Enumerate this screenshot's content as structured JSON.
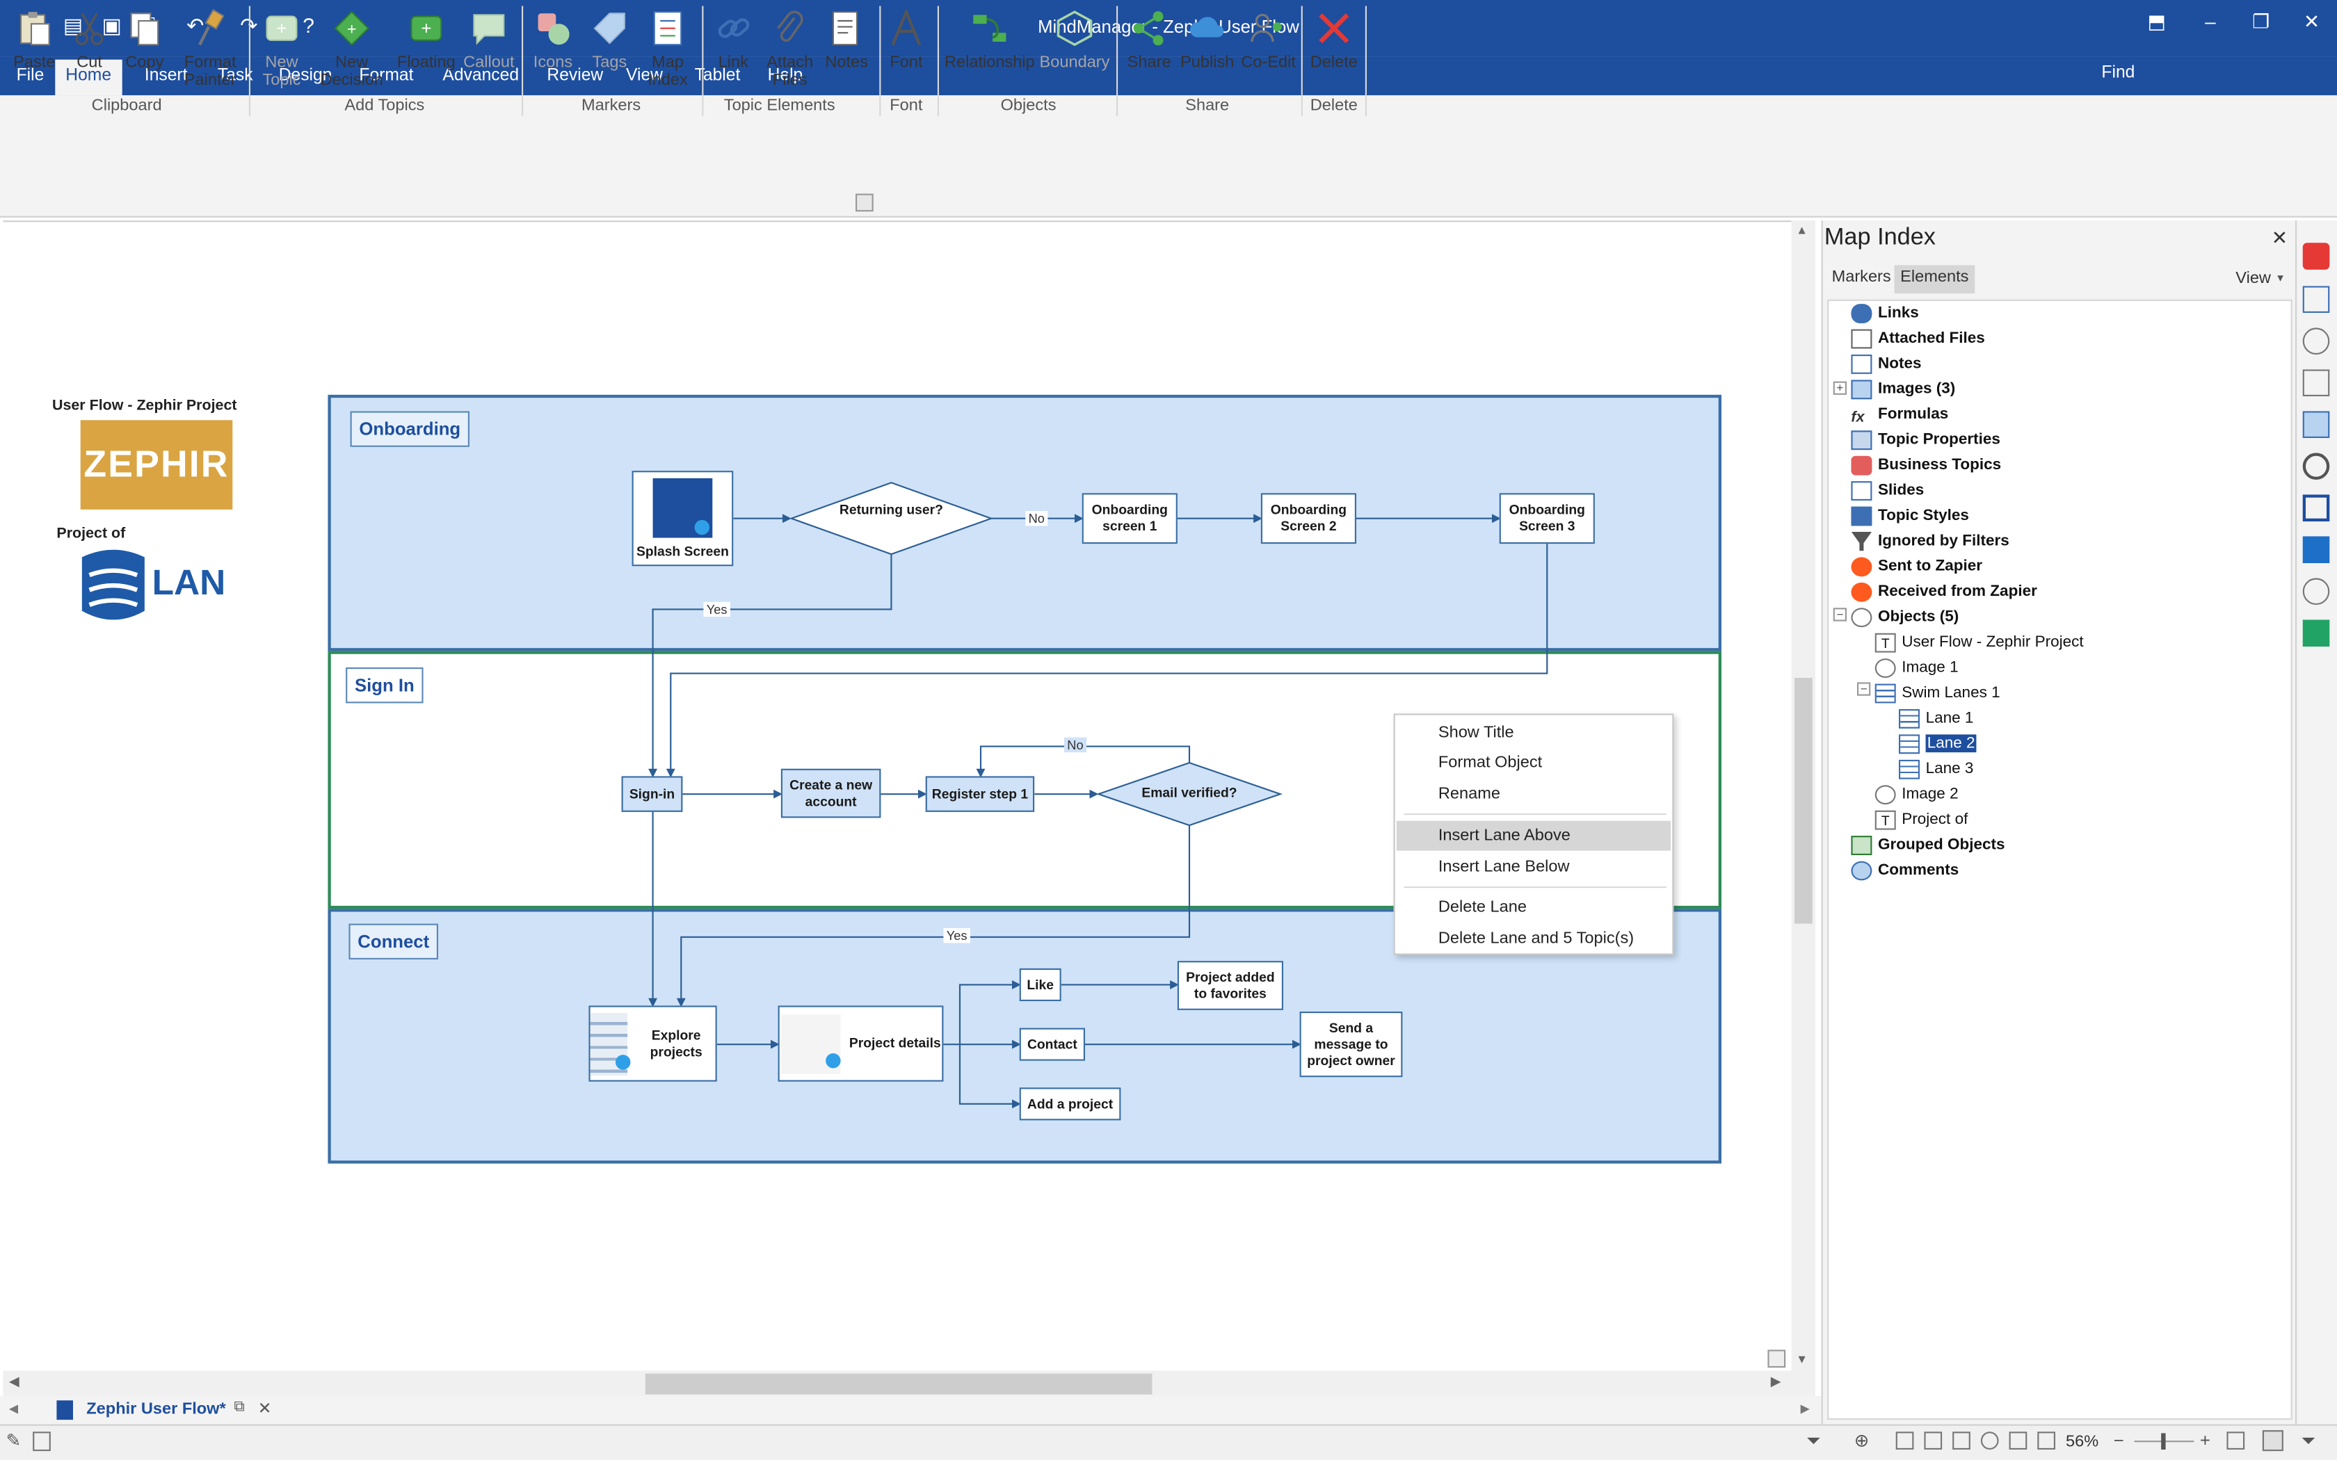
{
  "window": {
    "title": "MindManager - Zephir User Flow"
  },
  "menu": {
    "tabs": [
      "File",
      "Home",
      "Insert",
      "Task",
      "Design",
      "Format",
      "Advanced",
      "Review",
      "View",
      "Tablet",
      "Help"
    ],
    "find_label": "Find"
  },
  "ribbon": {
    "clipboard": {
      "paste": "Paste",
      "cut": "Cut",
      "copy": "Copy",
      "format_painter_1": "Format",
      "format_painter_2": "Painter",
      "group": "Clipboard"
    },
    "add_topics": {
      "new_topic_1": "New",
      "new_topic_2": "Topic",
      "new_decision_1": "New",
      "new_decision_2": "Decision",
      "floating": "Floating",
      "callout": "Callout",
      "group": "Add Topics"
    },
    "markers": {
      "icons": "Icons",
      "tags": "Tags",
      "map_index_1": "Map",
      "map_index_2": "Index",
      "group": "Markers"
    },
    "topic_elements": {
      "link": "Link",
      "attach_1": "Attach",
      "attach_2": "Files",
      "notes": "Notes",
      "group": "Topic Elements"
    },
    "font": {
      "font": "Font",
      "group": "Font"
    },
    "objects": {
      "relationship": "Relationship",
      "boundary": "Boundary",
      "group": "Objects"
    },
    "share": {
      "share": "Share",
      "publish": "Publish",
      "coedit": "Co-Edit",
      "group": "Share"
    },
    "delete": {
      "delete": "Delete",
      "group": "Delete"
    }
  },
  "canvas": {
    "header_title": "User Flow - Zephir Project",
    "logo_text": "ZEPHIR",
    "project_of": "Project of",
    "lan_text": "LAN",
    "lanes": [
      {
        "title": "Onboarding"
      },
      {
        "title": "Sign In"
      },
      {
        "title": "Connect"
      }
    ],
    "onboarding": {
      "splash": "Splash Screen",
      "returning": "Returning user?",
      "no": "No",
      "yes": "Yes",
      "screen1": "Onboarding screen 1",
      "screen2": "Onboarding Screen 2",
      "screen3": "Onboarding Screen 3"
    },
    "signin": {
      "signin": "Sign-in",
      "create": "Create a new account",
      "register": "Register step 1",
      "email": "Email verified?",
      "no": "No",
      "yes": "Yes"
    },
    "connect": {
      "explore": "Explore projects",
      "details": "Project details",
      "like": "Like",
      "contact": "Contact",
      "add": "Add a project",
      "favorites": "Project added to favorites",
      "message": "Send a message to project owner"
    }
  },
  "context_menu": {
    "items": [
      "Show Title",
      "Format Object",
      "Rename",
      "Insert Lane Above",
      "Insert Lane Below",
      "Delete Lane",
      "Delete Lane and 5 Topic(s)"
    ],
    "highlighted": "Insert Lane Above"
  },
  "map_index": {
    "title": "Map Index",
    "tabs": [
      "Markers",
      "Elements"
    ],
    "view_label": "View",
    "items": [
      "Links",
      "Attached Files",
      "Notes",
      "Images (3)",
      "Formulas",
      "Topic Properties",
      "Business Topics",
      "Slides",
      "Topic Styles",
      "Ignored by Filters",
      "Sent to Zapier",
      "Received from Zapier",
      "Objects (5)",
      "User Flow - Zephir Project",
      "Image 1",
      "Swim Lanes 1",
      "Lane 1",
      "Lane 2",
      "Lane 3",
      "Image 2",
      "Project of",
      "Grouped Objects",
      "Comments"
    ],
    "selected": "Lane 2"
  },
  "document_tab": {
    "label": "Zephir User Flow*"
  },
  "status": {
    "zoom": "56%"
  },
  "colors": {
    "brand": "#1e4e9e",
    "lane_fill": "#cfe2f7",
    "lane_border": "#3a6ea5",
    "highlight_lane_border": "#2e8b57"
  }
}
